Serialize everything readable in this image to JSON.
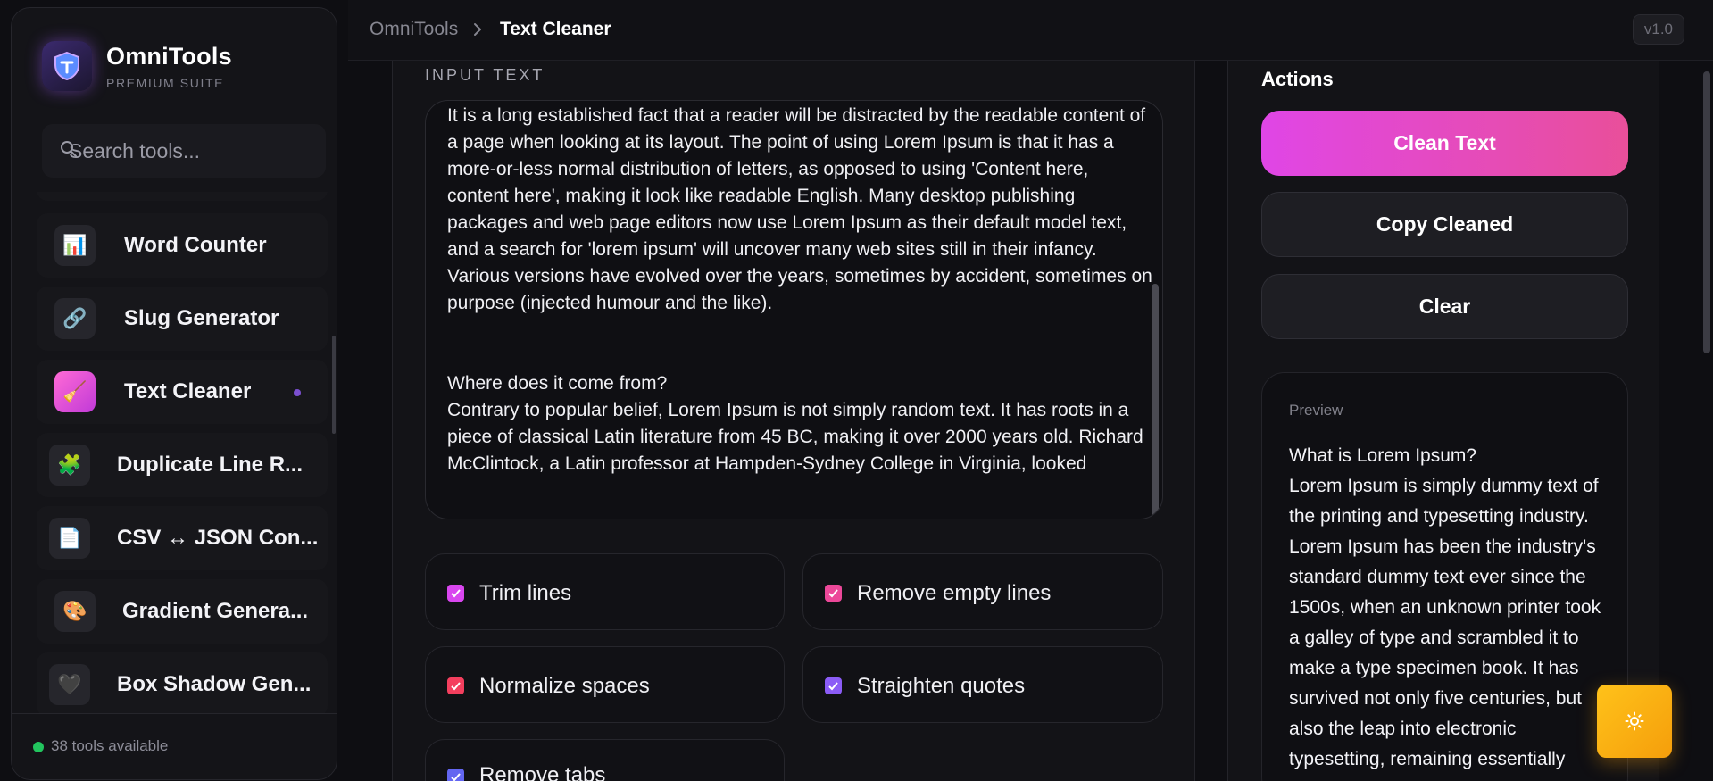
{
  "brand": {
    "name": "OmniTools",
    "subtitle": "PREMIUM SUITE"
  },
  "search": {
    "placeholder": "Search tools..."
  },
  "sidebar": {
    "items": [
      {
        "label": "Word Counter",
        "icon": "bar-chart-icon",
        "glyph": "📊"
      },
      {
        "label": "Slug Generator",
        "icon": "link-icon",
        "glyph": "🔗"
      },
      {
        "label": "Text Cleaner",
        "icon": "broom-icon",
        "glyph": "🧹",
        "active": true
      },
      {
        "label": "Duplicate Line R...",
        "icon": "puzzle-icon",
        "glyph": "🧩"
      },
      {
        "label": "CSV ↔ JSON Con...",
        "icon": "document-icon",
        "glyph": "📄"
      },
      {
        "label": "Gradient Genera...",
        "icon": "palette-icon",
        "glyph": "🎨"
      },
      {
        "label": "Box Shadow Gen...",
        "icon": "heart-icon",
        "glyph": "🖤"
      }
    ],
    "footer": "38 tools available"
  },
  "breadcrumb": {
    "root": "OmniTools",
    "current": "Text Cleaner"
  },
  "version": "v1.0",
  "input": {
    "label": "INPUT TEXT",
    "text": "It is a long established fact that a reader will be distracted by the readable content of a page when looking at its layout. The point of using Lorem Ipsum is that it has a more-or-less normal distribution of letters, as opposed to using 'Content here, content here', making it look like readable English. Many desktop publishing packages and web page editors now use Lorem Ipsum as their default model text, and a search for 'lorem ipsum' will uncover many web sites still in their infancy. Various versions have evolved over the years, sometimes by accident, sometimes on purpose (injected humour and the like).\n\n\nWhere does it come from?\nContrary to popular belief, Lorem Ipsum is not simply random text. It has roots in a piece of classical Latin literature from 45 BC, making it over 2000 years old. Richard McClintock, a Latin professor at Hampden-Sydney College in Virginia, looked"
  },
  "options": [
    {
      "label": "Trim lines",
      "checked": true,
      "color": "#d946ef"
    },
    {
      "label": "Remove empty lines",
      "checked": true,
      "color": "#ec4899"
    },
    {
      "label": "Normalize spaces",
      "checked": true,
      "color": "#f43f5e"
    },
    {
      "label": "Straighten quotes",
      "checked": true,
      "color": "#8b5cf6"
    },
    {
      "label": "Remove tabs",
      "checked": true,
      "color": "#6366f1"
    }
  ],
  "actions": {
    "title": "Actions",
    "clean": "Clean Text",
    "copy": "Copy Cleaned",
    "clear": "Clear"
  },
  "preview": {
    "label": "Preview",
    "text": "What is Lorem Ipsum?\nLorem Ipsum is simply dummy text of the printing and typesetting industry. Lorem Ipsum has been the industry's standard dummy text ever since the 1500s, when an unknown printer took a galley of type and scrambled it to make a type specimen book. It has survived not only five centuries, but also the leap into electronic typesetting, remaining essentially"
  },
  "theme_toggle": {
    "icon": "sun-icon",
    "glyph": "☀"
  },
  "colors": {
    "accent": "#e046e6",
    "accent2": "#e94f9a",
    "status": "#22c55e",
    "fab": "#f59e0b"
  }
}
